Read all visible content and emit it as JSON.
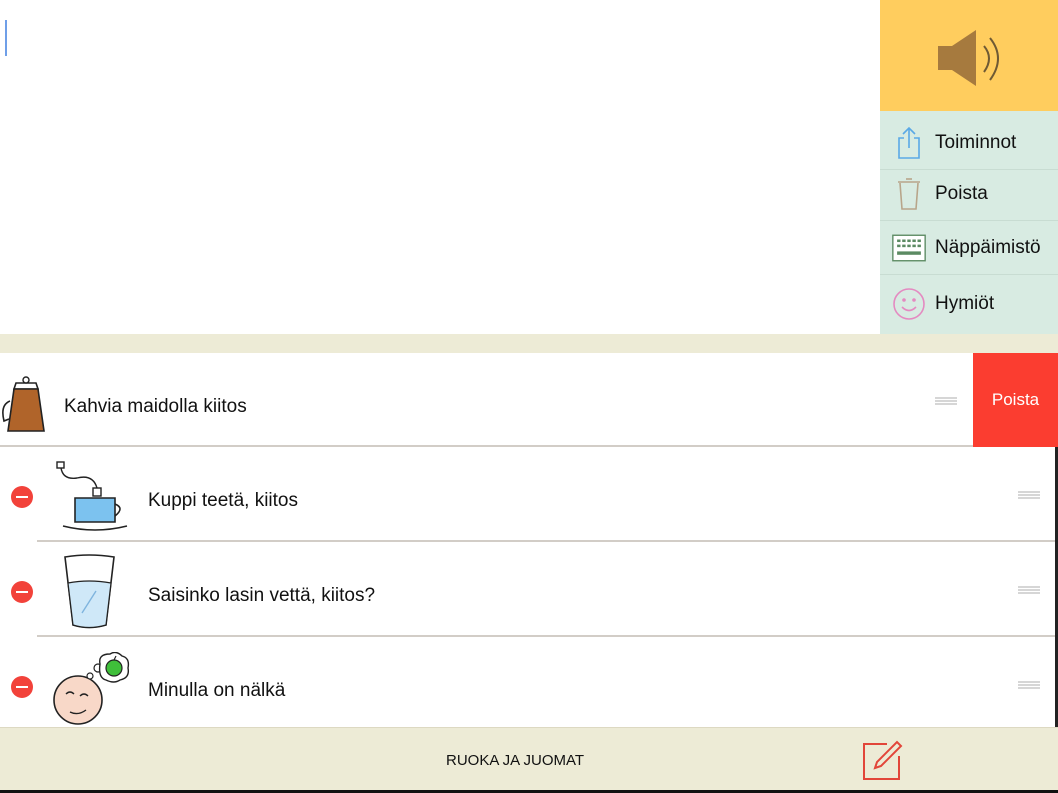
{
  "side_panel": {
    "speak_icon": "speaker-icon",
    "items": [
      {
        "label": "Toiminnot",
        "icon": "share-icon"
      },
      {
        "label": "Poista",
        "icon": "trash-icon"
      },
      {
        "label": "Näppäimistö",
        "icon": "keyboard-icon"
      },
      {
        "label": "Hymiöt",
        "icon": "smiley-icon"
      }
    ]
  },
  "phrases": [
    {
      "text": "Kahvia maidolla kiitos",
      "icon": "coffee-pot-icon"
    },
    {
      "text": "Kuppi teetä, kiitos",
      "icon": "tea-cup-icon"
    },
    {
      "text": "Saisinko lasin vettä, kiitos?",
      "icon": "water-glass-icon"
    },
    {
      "text": "Minulla on nälkä",
      "icon": "hungry-face-icon"
    }
  ],
  "swipe_delete_label": "Poista",
  "category_title": "RUOKA JA JUOMAT",
  "colors": {
    "speak_bg": "#ffcd5e",
    "menu_bg": "#d8ebe2",
    "band_bg": "#edebd6",
    "delete_red": "#fb3d30"
  }
}
